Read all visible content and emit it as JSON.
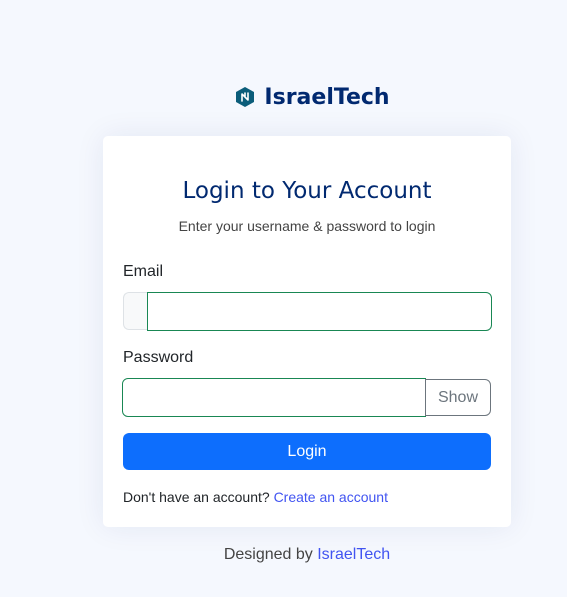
{
  "brand": {
    "name": "IsraelTech",
    "logo_icon": "hexagon-logo-icon",
    "color": "#012970"
  },
  "card": {
    "title": "Login to Your Account",
    "subtitle": "Enter your username & password to login",
    "email": {
      "label": "Email",
      "value": "",
      "placeholder": ""
    },
    "password": {
      "label": "Password",
      "value": "",
      "placeholder": "",
      "show_label": "Show"
    },
    "login_label": "Login",
    "signup": {
      "prompt": "Don't have an account?",
      "link_label": "Create an account"
    }
  },
  "credits": {
    "prefix": "Designed by",
    "link_label": "IsraelTech"
  },
  "colors": {
    "page_background": "#f5f8fe",
    "primary_button": "#0d6efd",
    "valid_border": "#198754",
    "link": "#4154f1",
    "heading": "#012970"
  }
}
